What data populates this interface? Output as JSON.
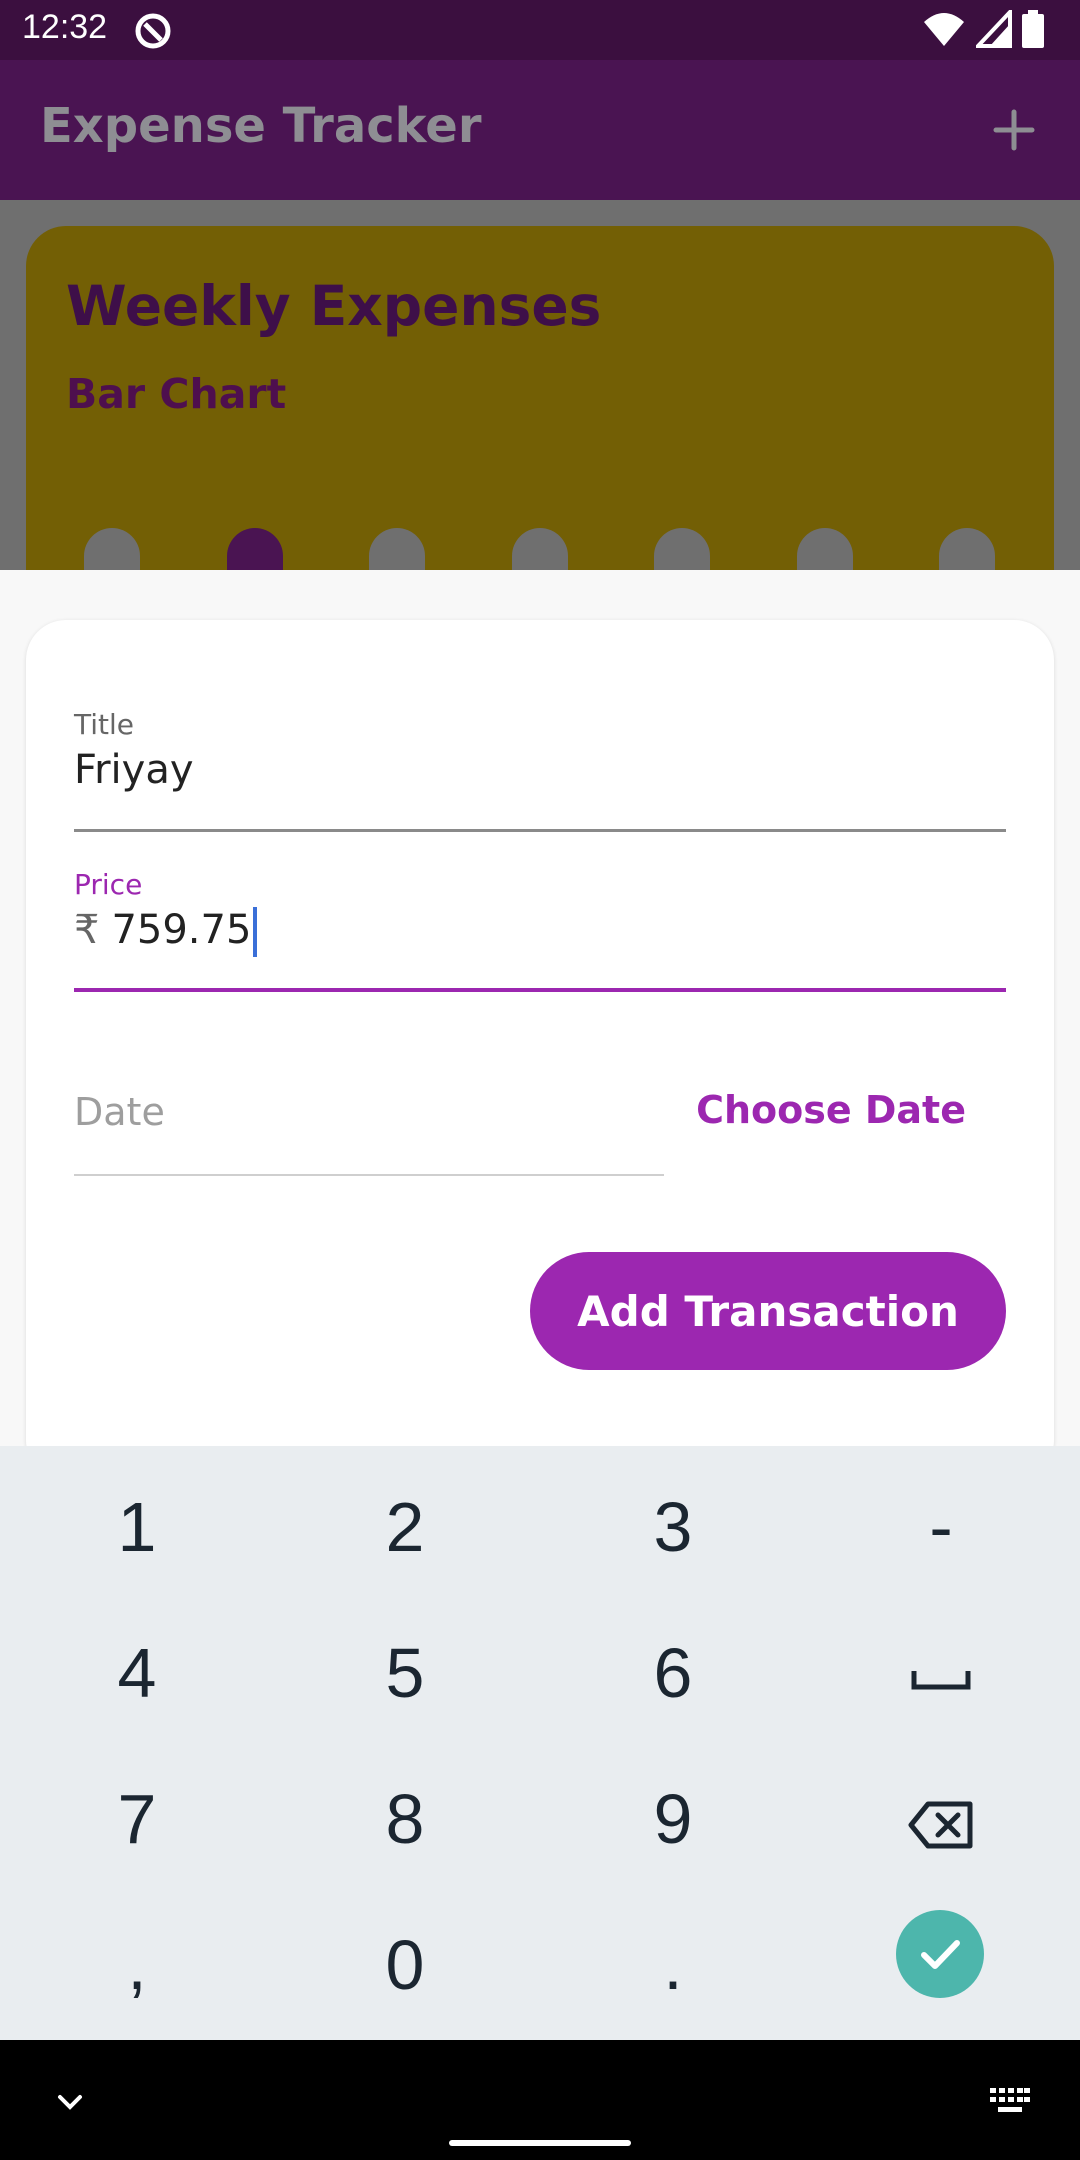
{
  "status_bar": {
    "time": "12:32"
  },
  "app_bar": {
    "title": "Expense Tracker"
  },
  "chart_card": {
    "heading": "Weekly Expenses",
    "subheading": "Bar Chart",
    "active_bar_index": 1,
    "bar_count": 7
  },
  "form": {
    "title_label": "Title",
    "title_value": "Friyay",
    "price_label": "Price",
    "price_prefix": "₹",
    "price_value": "759.75",
    "date_placeholder": "Date",
    "choose_date_label": "Choose Date",
    "submit_label": "Add Transaction"
  },
  "keyboard": {
    "keys": [
      "1",
      "2",
      "3",
      "-",
      "4",
      "5",
      "6",
      "space",
      "7",
      "8",
      "9",
      "backspace",
      ",",
      "0",
      ".",
      "done"
    ]
  },
  "colors": {
    "status_bar": "#3b0f3f",
    "app_bar": "#4a1452",
    "chart_card": "#735f05",
    "accent": "#9c27b0",
    "done_key": "#4db6ac",
    "keyboard_bg": "#e9edf0"
  }
}
